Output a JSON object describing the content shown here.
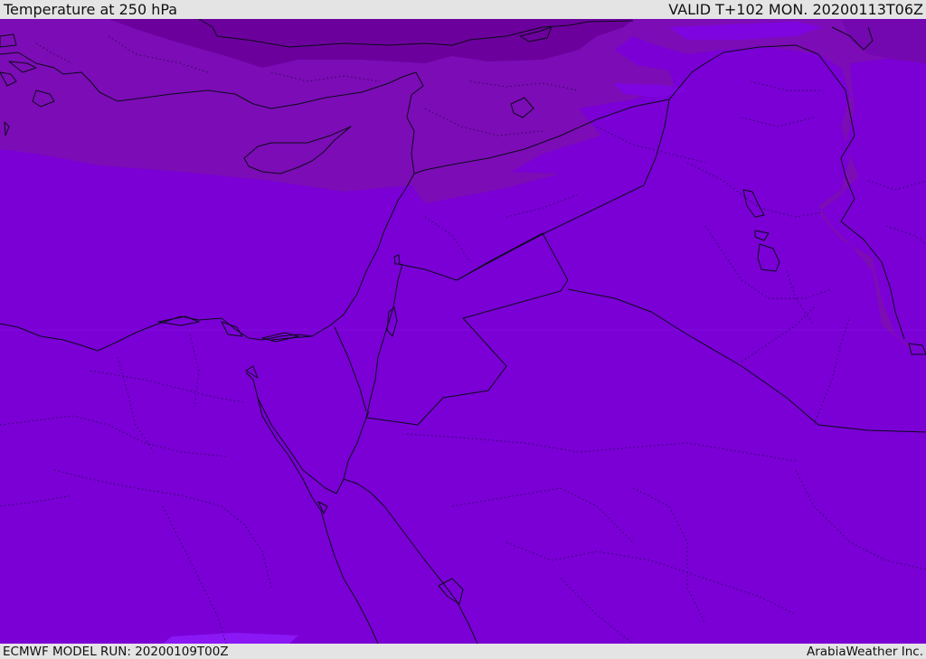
{
  "header": {
    "title": "Temperature at 250 hPa",
    "valid": "VALID T+102 MON. 20200113T06Z"
  },
  "footer": {
    "model_run": "ECMWF MODEL RUN: 20200109T00Z",
    "credit": "ArabiaWeather Inc."
  },
  "colors": {
    "field_main": "#7a00d6",
    "field_band": "#7c0cb6",
    "field_cold": "#6c009c",
    "field_warm_patch": "#8a14f0",
    "coastline": "#0b0b1a"
  }
}
